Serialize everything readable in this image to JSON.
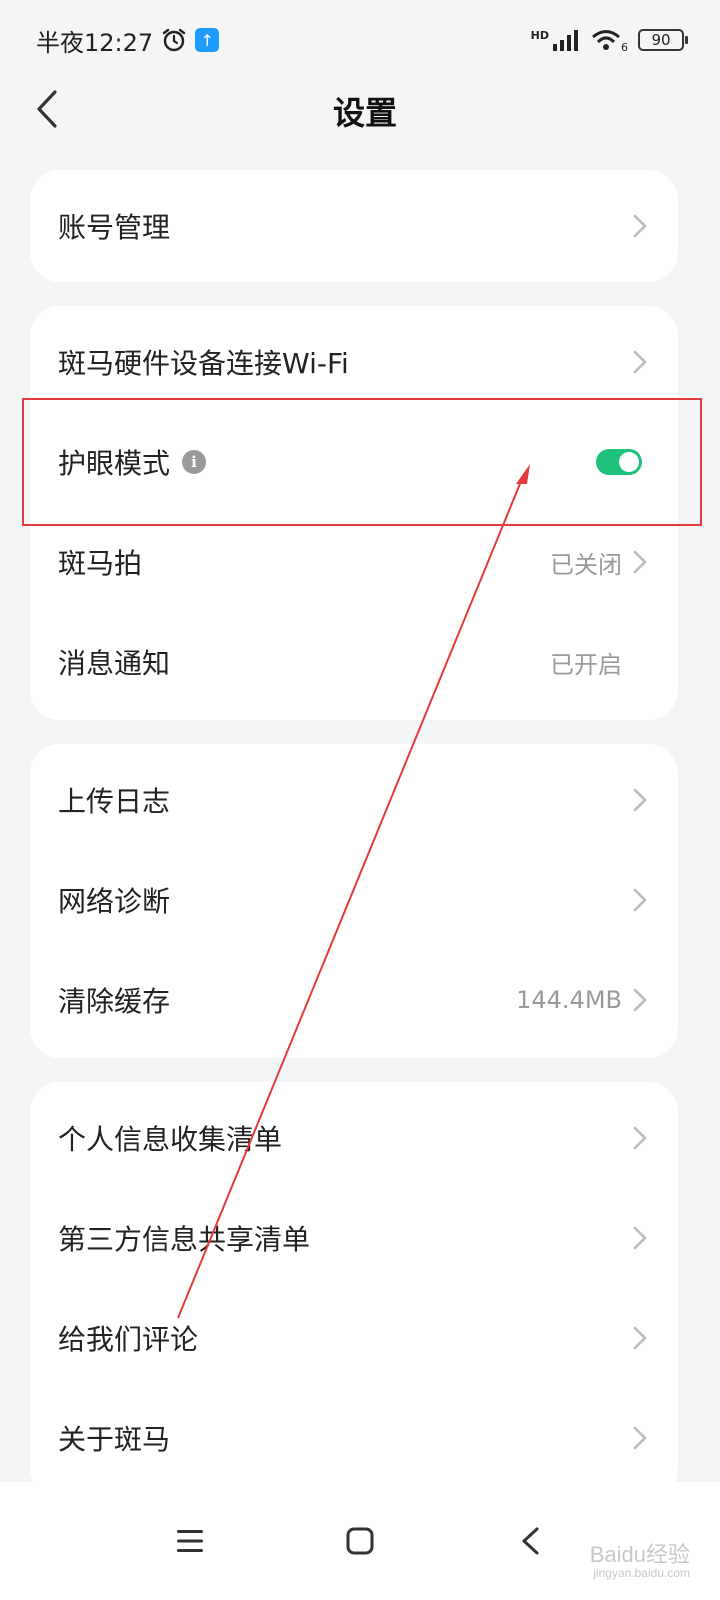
{
  "status_bar": {
    "time": "半夜12:27",
    "network": "HD",
    "wifi_sub": "6",
    "battery": "90"
  },
  "header": {
    "title": "设置"
  },
  "groups": [
    {
      "items": [
        {
          "label": "账号管理",
          "value": "",
          "chevron": true
        }
      ]
    },
    {
      "items": [
        {
          "label": "斑马硬件设备连接Wi-Fi",
          "value": "",
          "chevron": true
        },
        {
          "label": "护眼模式",
          "toggle": true,
          "toggle_on": true,
          "info": "i"
        },
        {
          "label": "斑马拍",
          "value": "已关闭",
          "chevron": true
        },
        {
          "label": "消息通知",
          "value": "已开启",
          "chevron": false
        }
      ]
    },
    {
      "items": [
        {
          "label": "上传日志",
          "value": "",
          "chevron": true
        },
        {
          "label": "网络诊断",
          "value": "",
          "chevron": true
        },
        {
          "label": "清除缓存",
          "value": "144.4MB",
          "chevron": true
        }
      ]
    },
    {
      "items": [
        {
          "label": "个人信息收集清单",
          "value": "",
          "chevron": true
        },
        {
          "label": "第三方信息共享清单",
          "value": "",
          "chevron": true
        },
        {
          "label": "给我们评论",
          "value": "",
          "chevron": true
        },
        {
          "label": "关于斑马",
          "value": "",
          "chevron": true
        }
      ]
    }
  ],
  "colors": {
    "accent_toggle": "#1ec27a",
    "annotation": "#e23b3b",
    "background": "#f4f5f7"
  },
  "watermark": {
    "brand": "Baidu经验",
    "url": "jingyan.baidu.com"
  }
}
